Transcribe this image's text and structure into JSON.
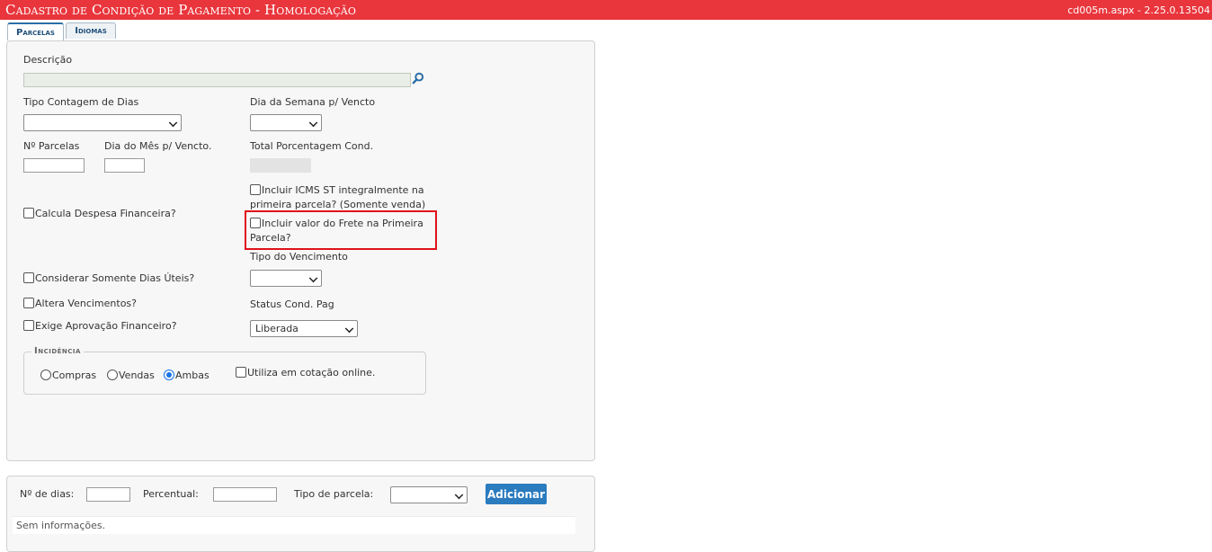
{
  "header": {
    "title": "Cadastro de Condição de Pagamento",
    "env": " - Homologação",
    "version": "cd005m.aspx - 2.25.0.13504"
  },
  "tabs": [
    {
      "label": "Parcelas",
      "active": true
    },
    {
      "label": "Idiomas",
      "active": false
    }
  ],
  "form": {
    "descricao_label": "Descrição",
    "descricao_value": "",
    "tipo_contagem_label": "Tipo Contagem de Dias",
    "tipo_contagem_value": "",
    "dia_semana_label": "Dia da Semana p/ Vencto",
    "dia_semana_value": "",
    "n_parcelas_label": "Nº Parcelas",
    "dia_mes_label": "Dia do Mês p/ Vencto.",
    "total_porc_label": "Total Porcentagem Cond.",
    "icms_st_label_1": "Incluir ICMS ST integralmente na",
    "icms_st_label_2": "primeira parcela? (Somente venda)",
    "calcula_despesa_label": "Calcula Despesa Financeira?",
    "frete_label_1": "Incluir valor do Frete na Primeira",
    "frete_label_2": "Parcela?",
    "tipo_venc_label": "Tipo do Vencimento",
    "tipo_venc_value": "",
    "dias_uteis_label": "Considerar Somente Dias Úteis?",
    "altera_venc_label": "Altera Vencimentos?",
    "status_label": "Status Cond. Pag",
    "status_value": "Liberada",
    "exige_aprov_label": "Exige Aprovação Financeiro?"
  },
  "incidencia": {
    "legend": "Incidência",
    "options": [
      "Compras",
      "Vendas",
      "Ambas"
    ],
    "selected": "Ambas",
    "cotacao_label": "Utiliza em cotação online."
  },
  "parcelas": {
    "dias_label": "Nº de dias:",
    "percentual_label": "Percentual:",
    "tipo_label": "Tipo de parcela:",
    "tipo_value": "",
    "add_button": "Adicionar",
    "empty_text": "Sem informações."
  },
  "colors": {
    "header_bg": "#e9353c",
    "button_bg": "#2b7bbf",
    "highlight": "#e0121a"
  }
}
